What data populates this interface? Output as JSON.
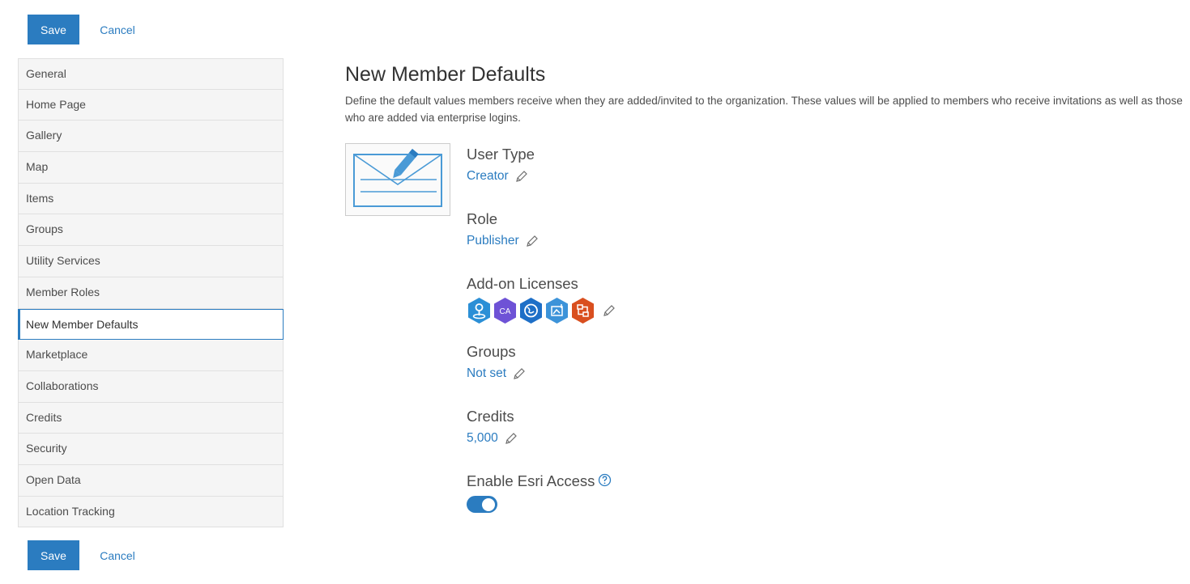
{
  "actions": {
    "save_label": "Save",
    "cancel_label": "Cancel"
  },
  "sidebar": {
    "items": [
      {
        "label": "General"
      },
      {
        "label": "Home Page"
      },
      {
        "label": "Gallery"
      },
      {
        "label": "Map"
      },
      {
        "label": "Items"
      },
      {
        "label": "Groups"
      },
      {
        "label": "Utility Services"
      },
      {
        "label": "Member Roles"
      },
      {
        "label": "New Member Defaults",
        "active": true
      },
      {
        "label": "Marketplace"
      },
      {
        "label": "Collaborations"
      },
      {
        "label": "Credits"
      },
      {
        "label": "Security"
      },
      {
        "label": "Open Data"
      },
      {
        "label": "Location Tracking"
      }
    ]
  },
  "main": {
    "title": "New Member Defaults",
    "description": "Define the default values members receive when they are added/invited to the organization. These values will be applied to members who receive invitations as well as those who are added via enterprise logins.",
    "illustration_icon": "envelope-edit-icon",
    "user_type": {
      "label": "User Type",
      "value": "Creator"
    },
    "role": {
      "label": "Role",
      "value": "Publisher"
    },
    "addon_licenses": {
      "label": "Add-on Licenses",
      "icons": [
        {
          "name": "app-license-icon-1",
          "color": "#2b8fd6"
        },
        {
          "name": "app-license-icon-ca",
          "color": "#6e52d6",
          "text": "CA"
        },
        {
          "name": "app-license-icon-globe",
          "color": "#1e6fc7"
        },
        {
          "name": "app-license-icon-upload",
          "color": "#3c93d9"
        },
        {
          "name": "app-license-icon-workflow",
          "color": "#d94f1f"
        }
      ]
    },
    "groups": {
      "label": "Groups",
      "value": "Not set"
    },
    "credits": {
      "label": "Credits",
      "value": "5,000"
    },
    "esri_access": {
      "label": "Enable Esri Access",
      "enabled": true
    }
  },
  "colors": {
    "accent": "#2b7cc0",
    "text": "#4c4c4c",
    "sidebar_bg": "#f5f5f5"
  }
}
